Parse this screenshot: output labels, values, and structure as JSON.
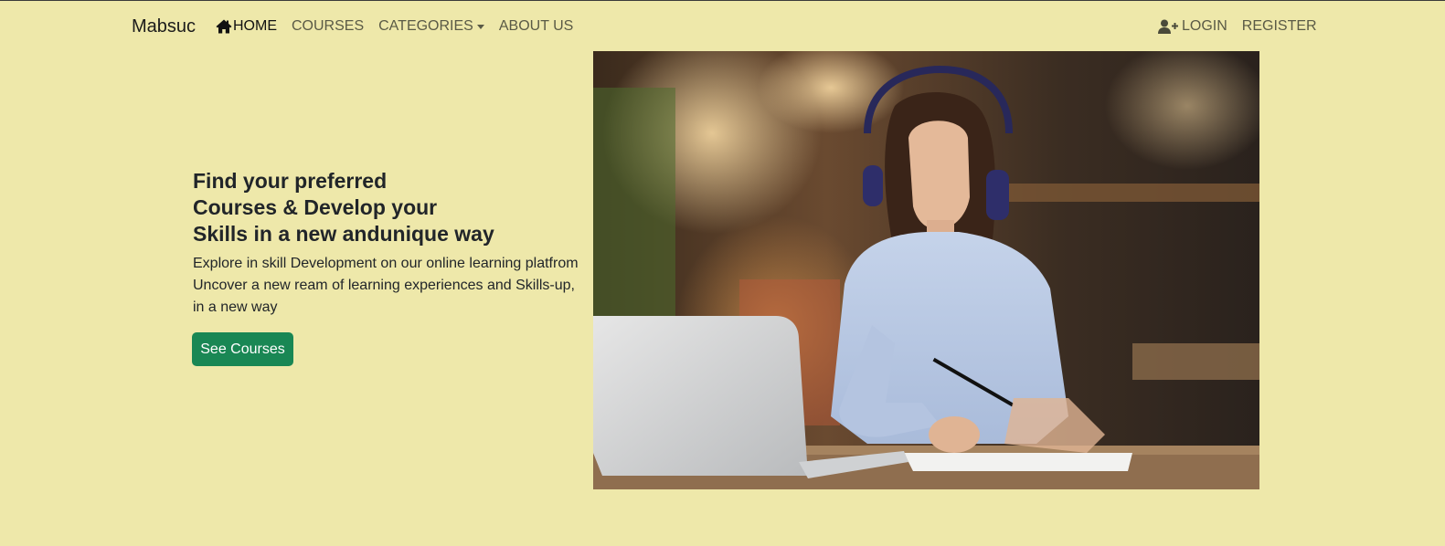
{
  "brand": "Mabsuc",
  "nav": {
    "home": "HOME",
    "courses": "COURSES",
    "categories": "CATEGORIES",
    "about": "ABOUT US",
    "login": "LOGIN",
    "register": "REGISTER"
  },
  "hero": {
    "headline": [
      "Find your preferred",
      "Courses & Develop your",
      "Skills in a new andunique way"
    ],
    "description": [
      "Explore in skill Development on our online learning platfrom",
      "Uncover a new ream of learning experiences and Skills-up,",
      "in a new way"
    ],
    "cta_label": "See Courses"
  },
  "icons": {
    "home": "home-icon",
    "login": "user-plus-icon",
    "categories": "caret-down-icon"
  },
  "colors": {
    "background": "#eee8aa",
    "cta": "#198754",
    "text": "#212529",
    "nav_text": "#5a5a46"
  }
}
